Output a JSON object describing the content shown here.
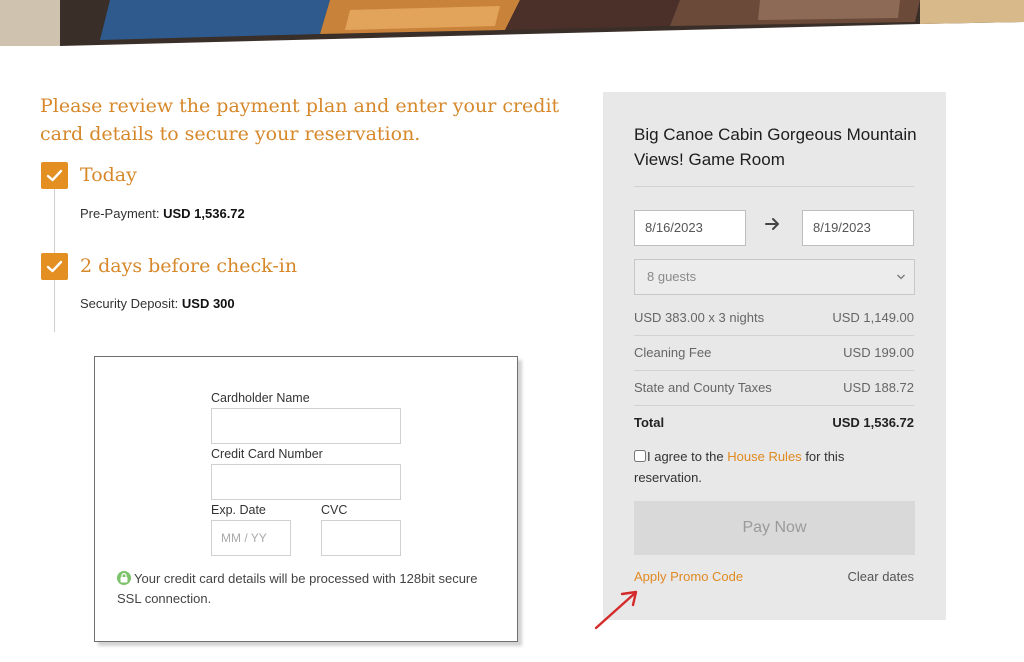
{
  "intro": {
    "text": "Please review the payment plan and enter your credit card details to secure your reservation."
  },
  "payment_plan": [
    {
      "title": "Today",
      "detail_label": "Pre-Payment:",
      "detail_value": "USD 1,536.72"
    },
    {
      "title": "2 days before check-in",
      "detail_label": "Security Deposit:",
      "detail_value": "USD 300"
    }
  ],
  "card_form": {
    "cardholder_label": "Cardholder Name",
    "cardholder_value": "",
    "card_number_label": "Credit Card Number",
    "card_number_value": "",
    "exp_label": "Exp. Date",
    "exp_placeholder": "MM / YY",
    "cvc_label": "CVC",
    "cvc_value": "",
    "ssl_note": "Your credit card details will be processed with 128bit secure SSL connection."
  },
  "booking": {
    "property_title": "Big Canoe Cabin Gorgeous Mountain Views! Game Room",
    "check_in": "8/16/2023",
    "check_out": "8/19/2023",
    "guests": "8 guests",
    "line_items": [
      {
        "label": "USD 383.00 x 3 nights",
        "amount": "USD 1,149.00"
      },
      {
        "label": "Cleaning Fee",
        "amount": "USD 199.00"
      },
      {
        "label": "State and County Taxes",
        "amount": "USD 188.72"
      }
    ],
    "total_label": "Total",
    "total_amount": "USD 1,536.72",
    "agree_prefix": "I agree to the",
    "agree_link": "House Rules",
    "agree_suffix": "for this reservation.",
    "pay_label": "Pay Now",
    "promo_label": "Apply Promo Code",
    "clear_label": "Clear dates"
  },
  "colors": {
    "accent": "#e08a22",
    "panel_bg": "#e8e8e8",
    "annotation_arrow": "#d42a2a"
  }
}
